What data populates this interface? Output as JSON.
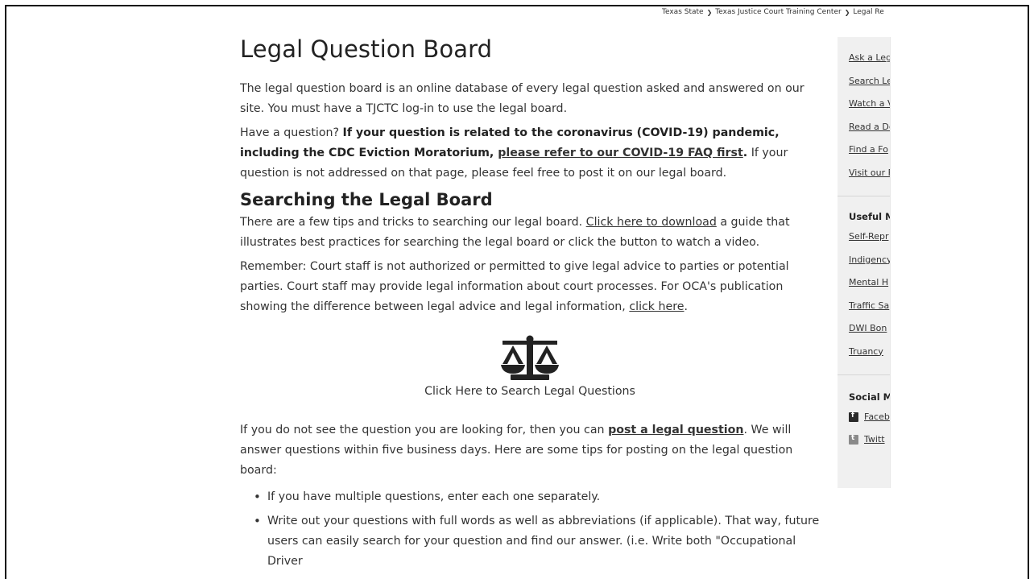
{
  "breadcrumb": [
    "Texas State",
    "Texas Justice Court Training Center",
    "Legal Re"
  ],
  "page_title": "Legal Question Board",
  "intro": "The legal question board is an online database of every legal question asked and answered on our site. You must have a TJCTC log-in to use the legal board.",
  "covid": {
    "lead": "Have a question? ",
    "bold": "If your question is related to the coronavirus (COVID-19) pandemic, including the CDC Eviction Moratorium, ",
    "link": "please refer to our COVID-19 FAQ first",
    "period": ".",
    "tail": " If your question is not addressed on that page, please feel free to post it on our legal board."
  },
  "section_title": "Searching the Legal Board",
  "tips_para": {
    "lead": "There are a few tips and tricks to searching our legal board. ",
    "link": "Click here to download",
    "tail": " a guide that illustrates best practices for searching the legal board or click the button to watch a video."
  },
  "remember_para": {
    "lead": "Remember: Court staff is not authorized or permitted to give legal advice to parties or potential parties. Court staff may provide legal information about court processes. For OCA's publication showing the difference between legal advice and legal information, ",
    "link": "click here",
    "tail": "."
  },
  "cta": {
    "icon": "scales-of-justice-icon",
    "label": "Click Here to Search Legal Questions"
  },
  "post_para": {
    "lead": "If you do not see the question you are looking for, then you can ",
    "link": "post a legal question",
    "tail": ". We will answer questions within five business days. Here are some tips for posting on the legal question board:"
  },
  "tips": [
    "If you have multiple questions, enter each one separately.",
    "Write out your questions with full words as well as abbreviations (if applicable). That way, future users can easily search for your question and find our answer. (i.e. Write both \"Occupational Driver"
  ],
  "sidebar": {
    "links": [
      "Ask a Leg",
      "Search Le",
      "Watch a V",
      "Read a De",
      "Find a Fo",
      "Visit our F"
    ],
    "useful_heading": "Useful M",
    "useful_links": [
      "Self-Repr",
      "Indigency",
      "Mental H",
      "Traffic Sa",
      "DWI Bon",
      "Truancy"
    ],
    "social_heading": "Social M",
    "social_links": [
      {
        "icon": "facebook-icon",
        "label": "Faceb"
      },
      {
        "icon": "twitter-icon",
        "label": "Twitt"
      }
    ]
  }
}
